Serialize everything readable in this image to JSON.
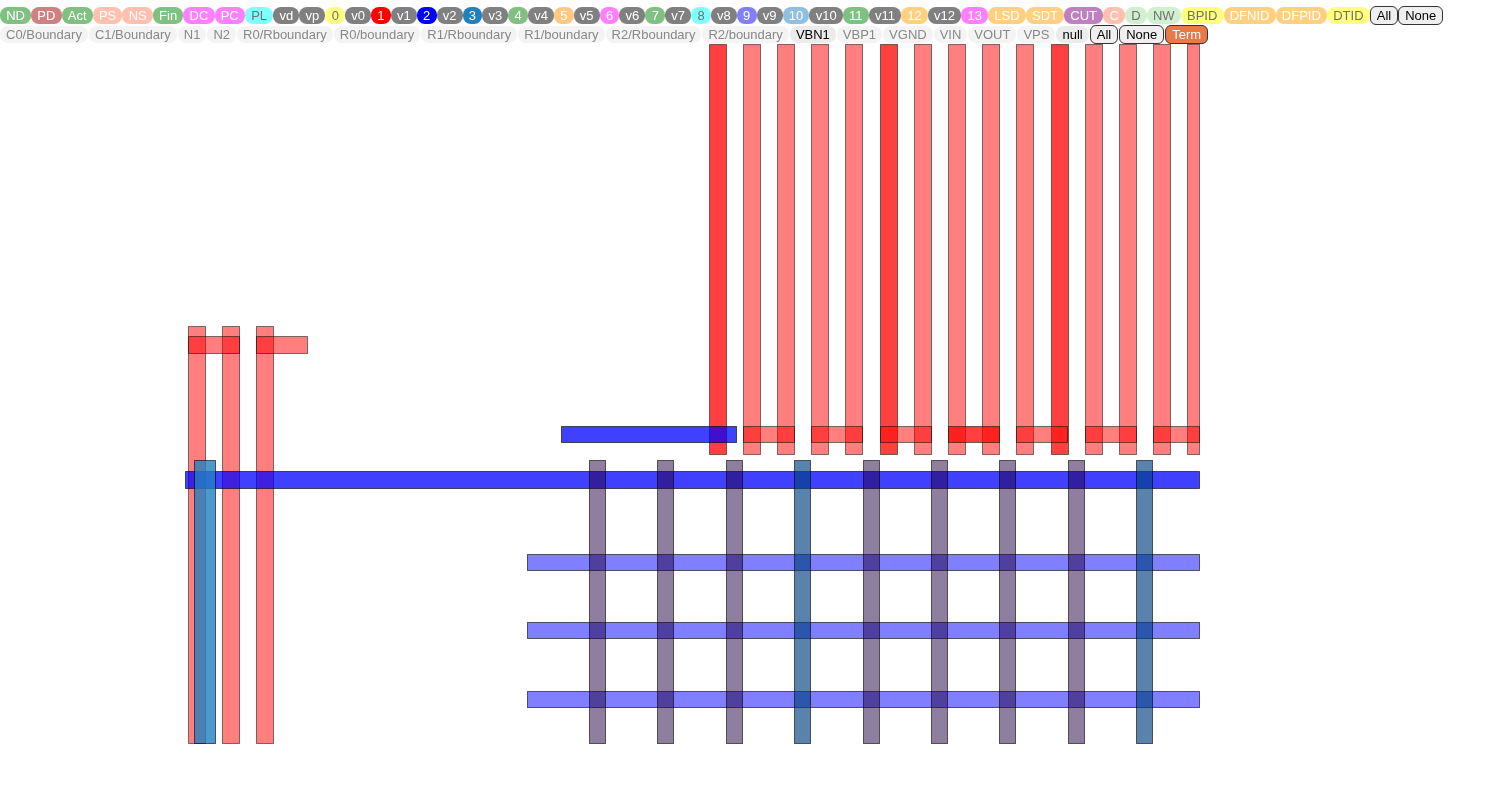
{
  "layer_toolbar": {
    "layers": [
      {
        "label": "ND",
        "color": "#80c080"
      },
      {
        "label": "PD",
        "color": "#d08080"
      },
      {
        "label": "Act",
        "color": "#80c080"
      },
      {
        "label": "PS",
        "color": "#ffc0b0"
      },
      {
        "label": "NS",
        "color": "#ffc0b0"
      },
      {
        "label": "Fin",
        "color": "#80c080"
      },
      {
        "label": "DC",
        "color": "#ff80ff"
      },
      {
        "label": "PC",
        "color": "#ff80ff"
      },
      {
        "label": "PL",
        "color": "#80ffff"
      },
      {
        "label": "vd",
        "color": "#808080"
      },
      {
        "label": "vp",
        "color": "#808080"
      },
      {
        "label": "0",
        "color": "#ffff80"
      },
      {
        "label": "v0",
        "color": "#808080"
      },
      {
        "label": "1",
        "color": "#ff0000"
      },
      {
        "label": "v1",
        "color": "#808080"
      },
      {
        "label": "2",
        "color": "#0000ff"
      },
      {
        "label": "v2",
        "color": "#808080"
      },
      {
        "label": "3",
        "color": "#2080c0"
      },
      {
        "label": "v3",
        "color": "#808080"
      },
      {
        "label": "4",
        "color": "#80c080"
      },
      {
        "label": "v4",
        "color": "#808080"
      },
      {
        "label": "5",
        "color": "#ffc880"
      },
      {
        "label": "v5",
        "color": "#808080"
      },
      {
        "label": "6",
        "color": "#ff80ff"
      },
      {
        "label": "v6",
        "color": "#808080"
      },
      {
        "label": "7",
        "color": "#80c080"
      },
      {
        "label": "v7",
        "color": "#808080"
      },
      {
        "label": "8",
        "color": "#80ffff"
      },
      {
        "label": "v8",
        "color": "#808080"
      },
      {
        "label": "9",
        "color": "#8080ff"
      },
      {
        "label": "v9",
        "color": "#808080"
      },
      {
        "label": "10",
        "color": "#90c0e0"
      },
      {
        "label": "v10",
        "color": "#808080"
      },
      {
        "label": "11",
        "color": "#80c080"
      },
      {
        "label": "v11",
        "color": "#808080"
      },
      {
        "label": "12",
        "color": "#ffd080"
      },
      {
        "label": "v12",
        "color": "#808080"
      },
      {
        "label": "13",
        "color": "#ff80ff"
      },
      {
        "label": "LSD",
        "color": "#ffd080"
      },
      {
        "label": "SDT",
        "color": "#ffd080"
      },
      {
        "label": "CUT",
        "color": "#c080c0"
      },
      {
        "label": "C",
        "color": "#ffc0b0"
      },
      {
        "label": "D",
        "color": "#d0f0d0"
      },
      {
        "label": "NW",
        "color": "#d0f0d0"
      },
      {
        "label": "BPID",
        "color": "#ffff80"
      },
      {
        "label": "DFNID",
        "color": "#ffd080"
      },
      {
        "label": "DFPID",
        "color": "#ffd080"
      },
      {
        "label": "DTID",
        "color": "#ffff80"
      }
    ],
    "buttons": [
      "All",
      "None"
    ]
  },
  "net_toolbar": {
    "nets": [
      {
        "label": "C0/Boundary",
        "selected": false
      },
      {
        "label": "C1/Boundary",
        "selected": false
      },
      {
        "label": "N1",
        "selected": false
      },
      {
        "label": "N2",
        "selected": false
      },
      {
        "label": "R0/Rboundary",
        "selected": false
      },
      {
        "label": "R0/boundary",
        "selected": false
      },
      {
        "label": "R1/Rboundary",
        "selected": false
      },
      {
        "label": "R1/boundary",
        "selected": false
      },
      {
        "label": "R2/Rboundary",
        "selected": false
      },
      {
        "label": "R2/boundary",
        "selected": false
      },
      {
        "label": "VBN1",
        "selected": true
      },
      {
        "label": "VBP1",
        "selected": false
      },
      {
        "label": "VGND",
        "selected": false
      },
      {
        "label": "VIN",
        "selected": false
      },
      {
        "label": "VOUT",
        "selected": false
      },
      {
        "label": "VPS",
        "selected": false
      },
      {
        "label": "null",
        "selected": true
      }
    ],
    "buttons": [
      {
        "label": "All",
        "on": false
      },
      {
        "label": "None",
        "on": false
      },
      {
        "label": "Term",
        "on": true
      }
    ]
  }
}
